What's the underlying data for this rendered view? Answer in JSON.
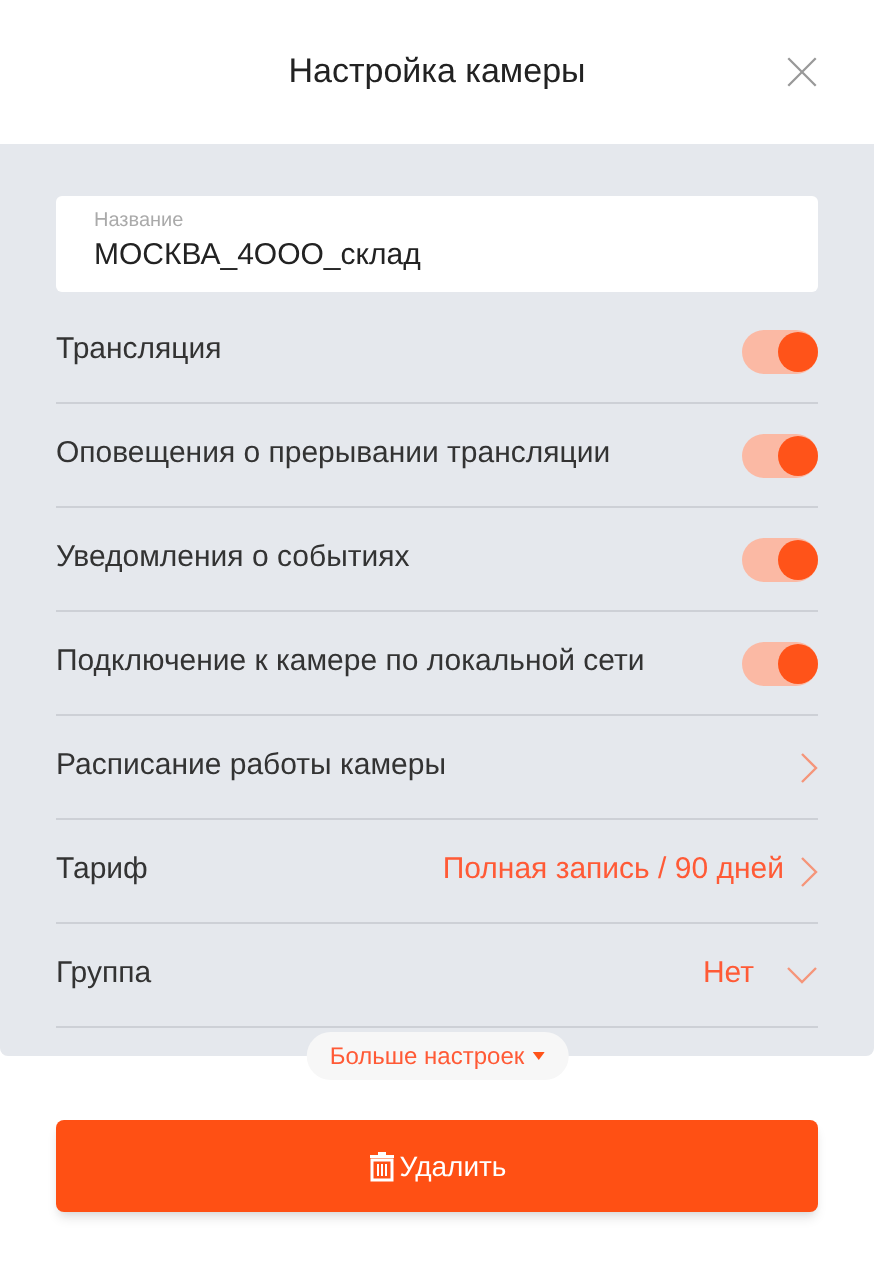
{
  "title": "Настройка камеры",
  "name_field": {
    "label": "Название",
    "value": "МОСКВА_4ООО_склад"
  },
  "rows": [
    {
      "kind": "toggle",
      "label": "Трансляция",
      "on": true
    },
    {
      "kind": "toggle",
      "label": "Оповещения о прерывании трансляции",
      "on": true
    },
    {
      "kind": "toggle",
      "label": "Уведомления о событиях",
      "on": true
    },
    {
      "kind": "toggle",
      "label": "Подключение к камере по локальной сети",
      "on": true
    },
    {
      "kind": "link",
      "label": "Расписание работы камеры"
    },
    {
      "kind": "link",
      "label": "Тариф",
      "value": "Полная запись / 90 дней"
    },
    {
      "kind": "select",
      "label": "Группа",
      "value": "Нет"
    }
  ],
  "more_button": "Больше настроек",
  "delete_button": "Удалить"
}
